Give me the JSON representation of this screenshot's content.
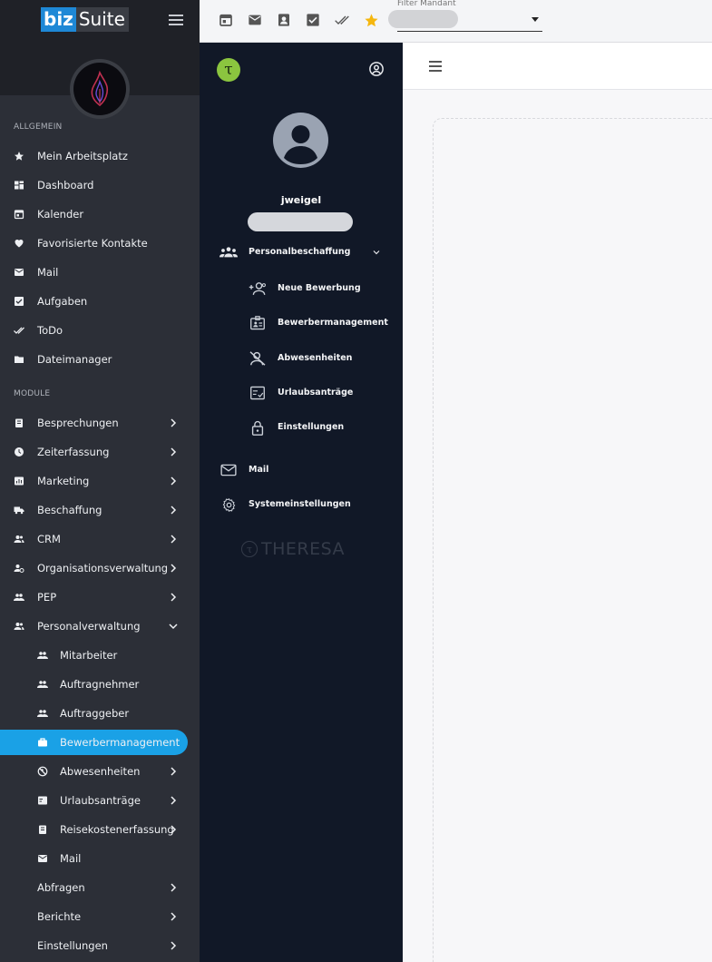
{
  "app": {
    "logo_biz": "biz",
    "logo_suite": "Suite"
  },
  "sidebar": {
    "section_general": "ALLGEMEIN",
    "general_items": [
      {
        "label": "Mein Arbeitsplatz",
        "icon": "star-icon"
      },
      {
        "label": "Dashboard",
        "icon": "dashboard-icon"
      },
      {
        "label": "Kalender",
        "icon": "calendar-icon"
      },
      {
        "label": "Favorisierte Kontakte",
        "icon": "heart-icon"
      },
      {
        "label": "Mail",
        "icon": "mail-icon"
      },
      {
        "label": "Aufgaben",
        "icon": "checkbox-icon"
      },
      {
        "label": "ToDo",
        "icon": "double-check-icon"
      },
      {
        "label": "Dateimanager",
        "icon": "folder-icon"
      }
    ],
    "section_modules": "MODULE",
    "module_items": [
      {
        "label": "Besprechungen",
        "icon": "clipboard-icon"
      },
      {
        "label": "Zeiterfassung",
        "icon": "clock-icon"
      },
      {
        "label": "Marketing",
        "icon": "chart-icon"
      },
      {
        "label": "Beschaffung",
        "icon": "truck-icon"
      },
      {
        "label": "CRM",
        "icon": "people-icon"
      },
      {
        "label": "Organisationsverwaltung",
        "icon": "person-gear-icon"
      },
      {
        "label": "PEP",
        "icon": "group-icon"
      },
      {
        "label": "Personalverwaltung",
        "icon": "people-icon"
      }
    ],
    "personal_sub_items": [
      {
        "label": "Mitarbeiter",
        "icon": "group-icon"
      },
      {
        "label": "Auftragnehmer",
        "icon": "group-icon"
      },
      {
        "label": "Auftraggeber",
        "icon": "group-icon"
      },
      {
        "label": "Bewerbermanagement",
        "icon": "briefcase-icon"
      },
      {
        "label": "Abwesenheiten",
        "icon": "blocked-icon"
      },
      {
        "label": "Urlaubsanträge",
        "icon": "form-icon"
      },
      {
        "label": "Reisekostenerfassung",
        "icon": "clipboard-icon"
      },
      {
        "label": "Mail",
        "icon": "mail-icon"
      }
    ],
    "bottom_items": [
      {
        "label": "Abfragen"
      },
      {
        "label": "Berichte"
      },
      {
        "label": "Einstellungen"
      }
    ]
  },
  "topbar": {
    "filter_label": "Filter Mandant",
    "icons": [
      "calendar-icon",
      "mail-icon",
      "contact-icon",
      "checkbox-icon",
      "double-check-icon",
      "star-icon"
    ],
    "star_color": "#f5b70f"
  },
  "panel": {
    "username": "jweigel",
    "group": {
      "label": "Personalbeschaffung",
      "icon": "people-add-icon"
    },
    "sub_items": [
      {
        "label": "Neue Bewerbung",
        "icon": "person-add-icon"
      },
      {
        "label": "Bewerbermanagement",
        "icon": "id-card-icon"
      },
      {
        "label": "Abwesenheiten",
        "icon": "person-off-icon"
      },
      {
        "label": "Urlaubsanträge",
        "icon": "form-check-icon"
      },
      {
        "label": "Einstellungen",
        "icon": "lock-icon"
      }
    ],
    "items": [
      {
        "label": "Mail",
        "icon": "mail-outline-icon"
      },
      {
        "label": "Systemeinstellungen",
        "icon": "gear-icon"
      }
    ],
    "brand_watermark": "THERESA",
    "logo_letter": "τ",
    "logo_color": "#8bc53f"
  },
  "colors": {
    "active": "#1aa1e6",
    "sidebar_bg": "#2c2f37",
    "panel_bg": "#111827"
  }
}
